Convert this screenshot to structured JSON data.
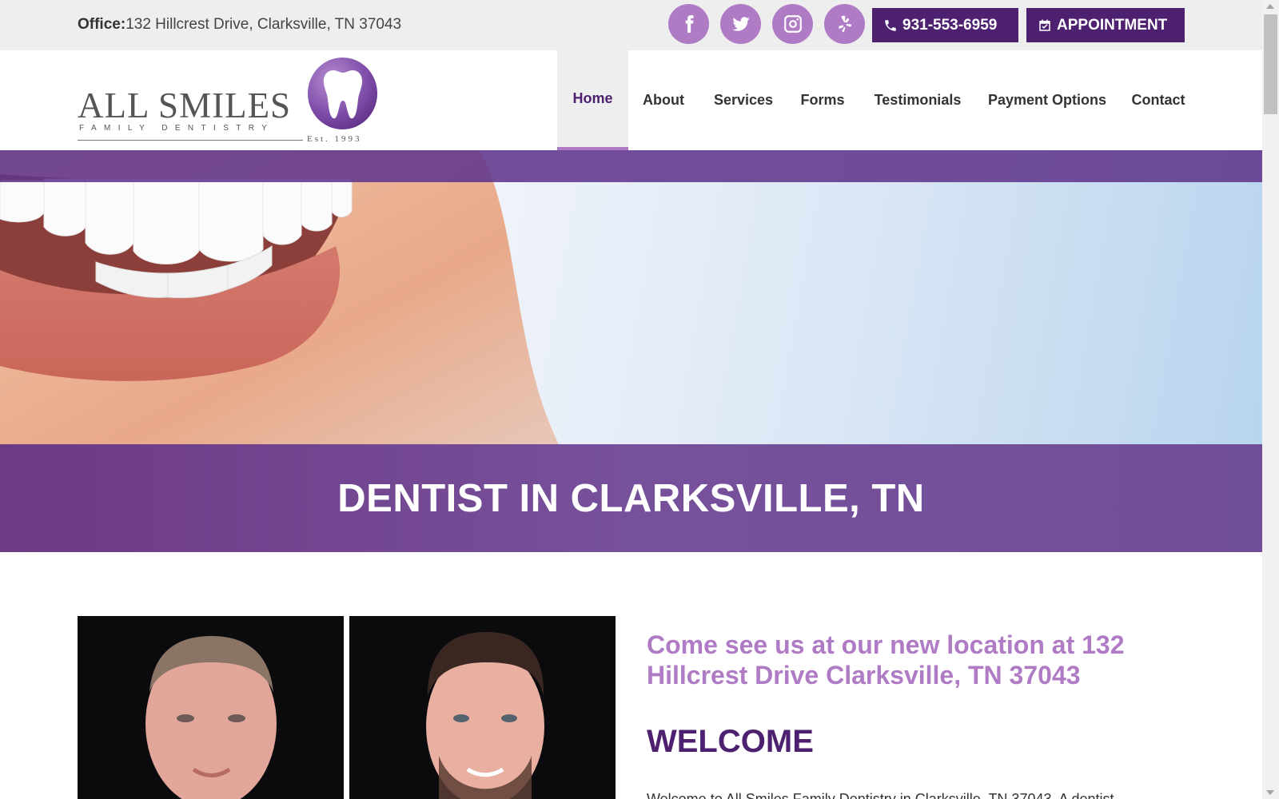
{
  "topbar": {
    "office_label": "Office:",
    "office_address": "132 Hillcrest Drive, Clarksville, TN 37043",
    "social": [
      "facebook-icon",
      "twitter-icon",
      "instagram-icon",
      "yelp-icon"
    ],
    "phone": "931-553-6959",
    "appointment": "APPOINTMENT"
  },
  "logo": {
    "name": "ALL SMILES",
    "subtitle": "FAMILY DENTISTRY",
    "est": "Est. 1993"
  },
  "nav": {
    "items": [
      "Home",
      "About",
      "Services",
      "Forms",
      "Testimonials",
      "Payment Options",
      "Contact"
    ],
    "active": "Home"
  },
  "hero": {
    "title": "DENTIST IN CLARKSVILLE, TN"
  },
  "content": {
    "lead": "Come see us at our new location at 132 Hillcrest Drive Clarksville, TN 37043",
    "welcome": "WELCOME",
    "intro": "Welcome to All Smiles Family Dentistry in Clarksville, TN 37043. A dentist"
  },
  "colors": {
    "brand_dark": "#4e2170",
    "brand_light": "#b07bc5",
    "hero_band": "#6f4a96"
  }
}
